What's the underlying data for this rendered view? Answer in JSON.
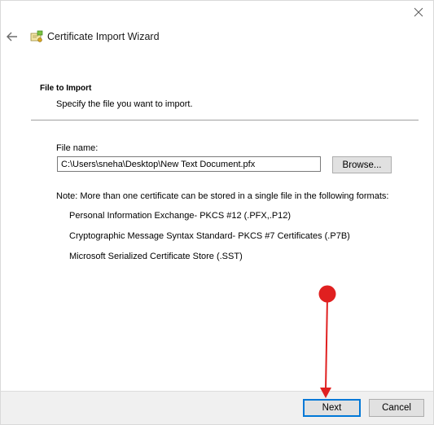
{
  "window": {
    "title": "Certificate Import Wizard",
    "icons": {
      "back": "back-arrow-icon",
      "close": "close-icon",
      "app": "certificate-icon"
    }
  },
  "section": {
    "title": "File to Import",
    "subtitle": "Specify the file you want to import."
  },
  "file_field": {
    "label": "File name:",
    "value": "C:\\Users\\sneha\\Desktop\\New Text Document.pfx",
    "browse_label": "Browse..."
  },
  "note": {
    "text": "Note:  More than one certificate can be stored in a single file in the following formats:",
    "formats": [
      "Personal Information Exchange- PKCS #12 (.PFX,.P12)",
      "Cryptographic Message Syntax Standard- PKCS #7 Certificates (.P7B)",
      "Microsoft Serialized Certificate Store (.SST)"
    ]
  },
  "footer": {
    "next_label": "Next",
    "cancel_label": "Cancel"
  },
  "colors": {
    "accent": "#0078d7",
    "annotation": "#e02020",
    "button_bg": "#e1e1e1",
    "footer_bg": "#f0f0f0"
  }
}
